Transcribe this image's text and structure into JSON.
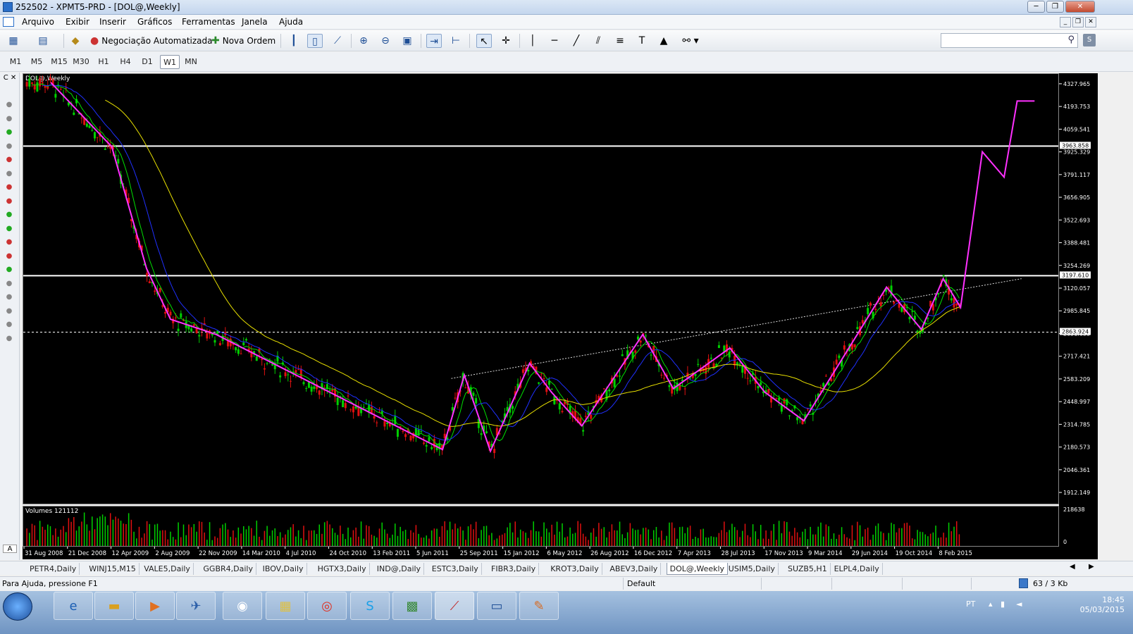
{
  "window": {
    "title": "252502 - XPMT5-PRD - [DOL@,Weekly]"
  },
  "menu": [
    "Arquivo",
    "Exibir",
    "Inserir",
    "Gráficos",
    "Ferramentas",
    "Janela",
    "Ajuda"
  ],
  "toolbar": {
    "auto_trading_label": "Negociação Automatizada",
    "new_order_label": "Nova Ordem"
  },
  "timeframes": [
    "M1",
    "M5",
    "M15",
    "M30",
    "H1",
    "H4",
    "D1",
    "W1",
    "MN"
  ],
  "selected_timeframe": "W1",
  "chart_data": {
    "type": "candlestick",
    "title": "DOL@,Weekly",
    "volume_label": "Volumes 121112",
    "y_ticks": [
      "4327.965",
      "4193.753",
      "4059.541",
      "3925.329",
      "3791.117",
      "3656.905",
      "3522.693",
      "3388.481",
      "3254.269",
      "3120.057",
      "2985.845",
      "2851.633",
      "2717.421",
      "2583.209",
      "2448.997",
      "2314.785",
      "2180.573",
      "2046.361",
      "1912.149"
    ],
    "volume_ticks": [
      "218638",
      "0"
    ],
    "x_ticks": [
      "31 Aug 2008",
      "21 Dec 2008",
      "12 Apr 2009",
      "2 Aug 2009",
      "22 Nov 2009",
      "14 Mar 2010",
      "4 Jul 2010",
      "24 Oct 2010",
      "13 Feb 2011",
      "5 Jun 2011",
      "25 Sep 2011",
      "15 Jan 2012",
      "6 May 2012",
      "26 Aug 2012",
      "16 Dec 2012",
      "7 Apr 2013",
      "28 Jul 2013",
      "17 Nov 2013",
      "9 Mar 2014",
      "29 Jun 2014",
      "19 Oct 2014",
      "8 Feb 2015"
    ],
    "price_labels": {
      "upper_hline": "3963.858",
      "lower_hline": "3197.610",
      "current": "2863.924"
    },
    "ylim": [
      1850,
      4390
    ],
    "zigzag_x_ticks": [
      0.6,
      2.0,
      2.8,
      3.35,
      4.4,
      9.6,
      10.1,
      10.7,
      11.6,
      12.1,
      12.8,
      14.2,
      14.9,
      16.2,
      17.0,
      17.9,
      19.8,
      20.6,
      21.1,
      21.5,
      22.0,
      22.5,
      22.8,
      22.95,
      23.2
    ],
    "zigzag_values": [
      4340,
      3960,
      3240,
      2940,
      2850,
      2170,
      2610,
      2160,
      2680,
      2510,
      2310,
      2850,
      2530,
      2770,
      2510,
      2340,
      3130,
      2880,
      3180,
      3010,
      3930,
      3780,
      4230,
      4230,
      4230
    ]
  },
  "symbol_tabs": [
    "PETR4,Daily",
    "WINJ15,M15",
    "VALE5,Daily",
    "GGBR4,Daily",
    "IBOV,Daily",
    "HGTX3,Daily",
    "IND@,Daily",
    "ESTC3,Daily",
    "FIBR3,Daily",
    "KROT3,Daily",
    "ABEV3,Daily",
    "DOL@,Weekly",
    "USIM5,Daily",
    "SUZB5,H1",
    "ELPL4,Daily"
  ],
  "active_tab": "DOL@,Weekly",
  "status": {
    "help": "Para Ajuda, pressione F1",
    "profile": "Default",
    "traffic": "63 / 3 Kb"
  },
  "taskbar": {
    "lang": "PT",
    "time": "18:45",
    "date": "05/03/2015"
  }
}
